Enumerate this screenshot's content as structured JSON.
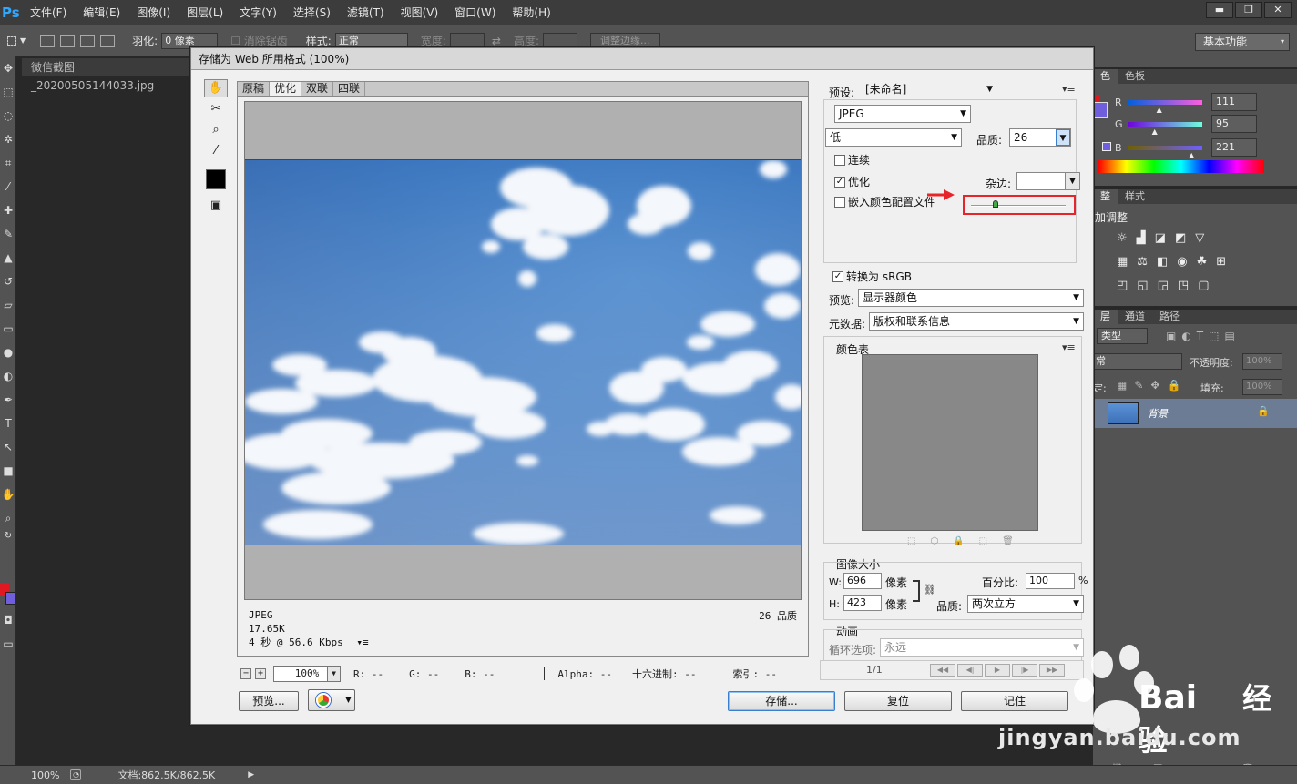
{
  "app": {
    "logo": "Ps",
    "menu": [
      "文件(F)",
      "编辑(E)",
      "图像(I)",
      "图层(L)",
      "文字(Y)",
      "选择(S)",
      "滤镜(T)",
      "视图(V)",
      "窗口(W)",
      "帮助(H)"
    ],
    "window_buttons": [
      "▬",
      "❐",
      "✕"
    ]
  },
  "options_bar": {
    "feather_label": "羽化:",
    "feather_value": "0 像素",
    "antialias_label": "消除锯齿",
    "style_label": "样式:",
    "style_value": "正常",
    "width_label": "宽度:",
    "height_label": "高度:",
    "refine_edge_label": "调整边缘...",
    "workspace": "基本功能"
  },
  "document": {
    "tab_name": "微信截图_20200505144033.jpg",
    "zoom": "100%",
    "doc_size": "文档:862.5K/862.5K"
  },
  "color_panel": {
    "tabs": [
      "色",
      "色板"
    ],
    "r_label": "R",
    "r_value": "111",
    "r_fraction": 0.435,
    "g_label": "G",
    "g_value": "95",
    "g_fraction": 0.373,
    "b_label": "B",
    "b_value": "221",
    "b_fraction": 0.867
  },
  "adjust_panel": {
    "tabs": [
      "整",
      "样式"
    ],
    "title": "加调整"
  },
  "layers_panel": {
    "tabs": [
      "层",
      "通道",
      "路径"
    ],
    "kind_label": "类型",
    "blend_mode": "常",
    "opacity_label": "不透明度:",
    "opacity_value": "100%",
    "lock_label": "定:",
    "fill_label": "填充:",
    "fill_value": "100%",
    "layer_name": "背景"
  },
  "dialog": {
    "title": "存储为 Web 所用格式 (100%)",
    "view_tabs": [
      "原稿",
      "优化",
      "双联",
      "四联"
    ],
    "active_view_tab": "优化",
    "preview_info": {
      "format": "JPEG",
      "size": "17.65K",
      "speed": "4 秒 @ 56.6 Kbps",
      "speed_menu": "▾≡",
      "quality_text": "26 品质"
    },
    "zoom_value": "100%",
    "readouts": {
      "r": "R: --",
      "g": "G: --",
      "b": "B: --",
      "alpha": "Alpha: --",
      "hex": "十六进制: --",
      "index": "索引: --"
    },
    "buttons": {
      "preview": "预览...",
      "save": "存储...",
      "reset": "复位",
      "remember": "记住"
    },
    "settings": {
      "preset_label": "预设:",
      "preset_value": "[未命名]",
      "format_value": "JPEG",
      "compression_value": "低",
      "quality_label": "品质:",
      "quality_value": "26",
      "quality_fraction": 0.26,
      "progressive_label": "连续",
      "progressive_checked": false,
      "optimized_label": "优化",
      "optimized_checked": true,
      "blur_label": "杂边:",
      "embed_profile_label": "嵌入颜色配置文件",
      "embed_profile_checked": false,
      "convert_srgb_label": "转换为 sRGB",
      "convert_srgb_checked": true,
      "preview_label": "预览:",
      "preview_value": "显示器颜色",
      "metadata_label": "元数据:",
      "metadata_value": "版权和联系信息",
      "color_table_label": "颜色表",
      "image_size_label": "图像大小",
      "w_label": "W:",
      "w_value": "696",
      "h_label": "H:",
      "h_value": "423",
      "unit_px": "像素",
      "percent_label": "百分比:",
      "percent_value": "100",
      "percent_unit": "%",
      "resample_label": "品质:",
      "resample_value": "两次立方",
      "animation_label": "动画",
      "loop_label": "循环选项:",
      "loop_value": "永远",
      "frame_counter": "1/1"
    }
  },
  "watermark": {
    "brand": "Bai",
    "brand_cn": "经验",
    "url": "jingyan.baidu.com"
  },
  "colors": {
    "accent_red": "#e8242b",
    "fg_swatch": "#e01822",
    "bg_swatch": "#6f5fdd"
  }
}
